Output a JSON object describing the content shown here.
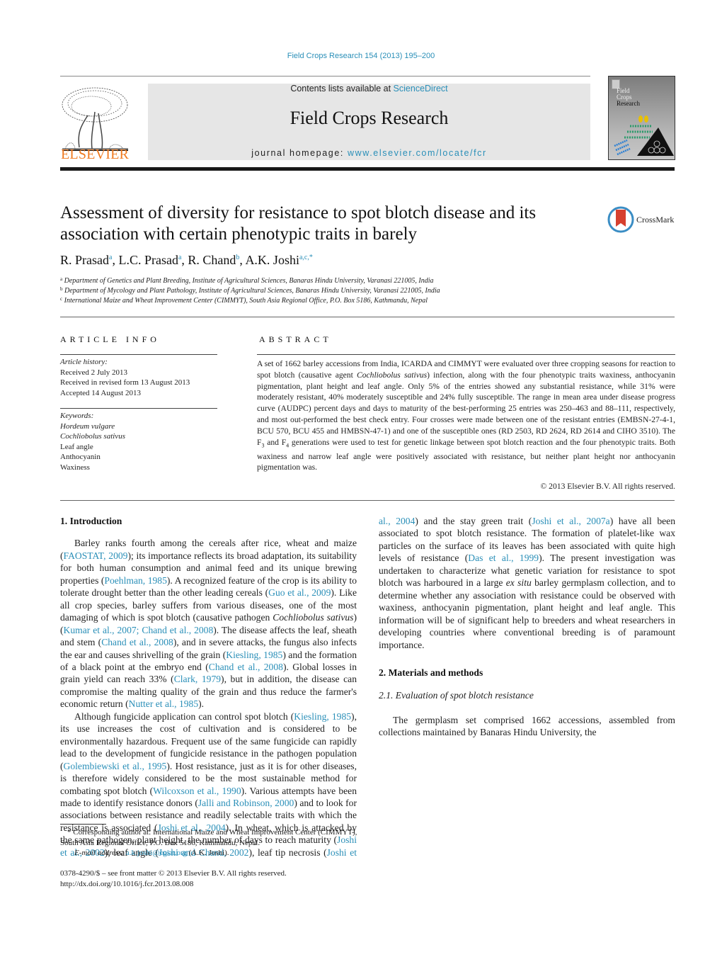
{
  "header": {
    "journal_reference": "Field Crops Research 154 (2013) 195–200",
    "publisher_logo_text": "ELSEVIER",
    "contents_prefix": "Contents lists available at ",
    "contents_link": "ScienceDirect",
    "journal_title": "Field Crops Research",
    "homepage_prefix": "journal homepage: ",
    "homepage_link": "www.elsevier.com/locate/fcr",
    "cover_title_lines": [
      "Field",
      "Crops",
      "Research"
    ]
  },
  "article": {
    "title": "Assessment of diversity for resistance to spot blotch disease and its association with certain phenotypic traits in barely",
    "crossmark_label": "CrossMark",
    "authors": [
      {
        "name": "R. Prasad",
        "sup": "a"
      },
      {
        "name": "L.C. Prasad",
        "sup": "a"
      },
      {
        "name": "R. Chand",
        "sup": "b"
      },
      {
        "name": "A.K. Joshi",
        "sup": "a,c,*"
      }
    ],
    "affiliations": [
      {
        "mark": "a",
        "text": "Department of Genetics and Plant Breeding, Institute of Agricultural Sciences, Banaras Hindu University, Varanasi 221005, India"
      },
      {
        "mark": "b",
        "text": "Department of Mycology and Plant Pathology, Institute of Agricultural Sciences, Banaras Hindu University, Varanasi 221005, India"
      },
      {
        "mark": "c",
        "text": "International Maize and Wheat Improvement Center (CIMMYT), South Asia Regional Office, P.O. Box 5186, Kathmandu, Nepal"
      }
    ]
  },
  "article_info": {
    "heading": "ARTICLE INFO",
    "history_label": "Article history:",
    "history": [
      "Received 2 July 2013",
      "Received in revised form 13 August 2013",
      "Accepted 14 August 2013"
    ],
    "keywords_label": "Keywords:",
    "keywords_italic": [
      "Hordeum vulgare",
      "Cochliobolus sativus"
    ],
    "keywords": [
      "Leaf angle",
      "Anthocyanin",
      "Waxiness"
    ]
  },
  "abstract": {
    "heading": "ABSTRACT",
    "part1": "A set of 1662 barley accessions from India, ICARDA and CIMMYT were evaluated over three cropping seasons for reaction to spot blotch (causative agent ",
    "species": "Cochliobolus sativus",
    "part2": ") infection, along with the four phenotypic traits waxiness, anthocyanin pigmentation, plant height and leaf angle. Only 5% of the entries showed any substantial resistance, while 31% were moderately resistant, 40% moderately susceptible and 24% fully susceptible. The range in mean area under disease progress curve (AUDPC) percent days and days to maturity of the best-performing 25 entries was 250–463 and 88–111, respectively, and most out-performed the best check entry. Four crosses were made between one of the resistant entries (EMBSN-27-4-1, BCU 570, BCU 455 and HMBSN-47-1) and one of the susceptible ones (RD 2503, RD 2624, RD 2614 and CIHO 3510). The F",
    "sub3": "3",
    "part3": " and F",
    "sub4": "4",
    "part4": " generations were used to test for genetic linkage between spot blotch reaction and the four phenotypic traits. Both waxiness and narrow leaf angle were positively associated with resistance, but neither plant height nor anthocyanin pigmentation was.",
    "copyright": "© 2013 Elsevier B.V. All rights reserved."
  },
  "intro": {
    "heading": "1.  Introduction",
    "p1": [
      {
        "t": "Barley ranks fourth among the cereals after rice, wheat and maize ("
      },
      {
        "l": "FAOSTAT, 2009"
      },
      {
        "t": "); its importance reflects its broad adaptation, its suitability for both human consumption and animal feed and its unique brewing properties ("
      },
      {
        "l": "Poehlman, 1985"
      },
      {
        "t": "). A recognized feature of the crop is its ability to tolerate drought better than the other leading cereals ("
      },
      {
        "l": "Guo et al., 2009"
      },
      {
        "t": "). Like all crop species, barley suffers from various diseases, one of the most damaging of which is spot blotch (causative pathogen "
      },
      {
        "i": "Cochliobolus sativus"
      },
      {
        "t": ") ("
      },
      {
        "l": "Kumar et al., 2007; Chand et al., 2008"
      },
      {
        "t": "). The disease affects the leaf, sheath and stem ("
      },
      {
        "l": "Chand et al., 2008"
      },
      {
        "t": "), and in severe attacks, the fungus also infects the ear and causes shrivelling of the grain ("
      },
      {
        "l": "Kiesling, 1985"
      },
      {
        "t": ") and the formation of a black point at the embryo end ("
      },
      {
        "l": "Chand et al., 2008"
      },
      {
        "t": "). Global losses in grain yield can reach 33% ("
      },
      {
        "l": "Clark, 1979"
      },
      {
        "t": "), but in addition, the disease can compromise the malting quality of the grain and thus reduce the farmer's economic return ("
      },
      {
        "l": "Nutter et al., 1985"
      },
      {
        "t": ")."
      }
    ],
    "p2": [
      {
        "t": "Although fungicide application can control spot blotch ("
      },
      {
        "l": "Kiesling, 1985"
      },
      {
        "t": "), its use increases the cost of cultivation and is considered to be environmentally hazardous. Frequent use of the same fungicide can rapidly lead to the development of fungicide resistance in the pathogen population ("
      },
      {
        "l": "Golembiewski et al., 1995"
      },
      {
        "t": "). Host resistance, just as it is for other diseases, is therefore widely considered to be the most sustainable method for combating spot blotch ("
      },
      {
        "l": "Wilcoxson et al., 1990"
      },
      {
        "t": "). Various attempts have been made to identify resistance donors ("
      },
      {
        "l": "Jalli and Robinson, 2000"
      },
      {
        "t": ") and to look for associations between resistance and readily selectable traits with which the resistance is associated ("
      },
      {
        "l": "Joshi et al., 2004"
      },
      {
        "t": "). In wheat, which is attacked by the same pathogen, plant height, the number of days to reach maturity ("
      },
      {
        "l": "Joshi et al., 2002"
      },
      {
        "t": "), leaf angle ("
      },
      {
        "l": "Joshi and Chand, 2002"
      },
      {
        "t": "), leaf tip necrosis ("
      },
      {
        "l": "Joshi et al., 2004"
      },
      {
        "t": ") and the stay green trait ("
      },
      {
        "l": "Joshi et al., 2007a"
      },
      {
        "t": ") have all been associated to spot blotch resistance. The formation of platelet-like wax particles on the surface of its leaves has been associated with quite high levels of resistance ("
      },
      {
        "l": "Das et al., 1999"
      },
      {
        "t": "). The present investigation was undertaken to characterize what genetic variation for resistance to spot blotch was harboured in a large "
      },
      {
        "i": "ex situ"
      },
      {
        "t": " barley germplasm collection, and to determine whether any association with resistance could be observed with waxiness, anthocyanin pigmentation, plant height and leaf angle. This information will be of significant help to breeders and wheat researchers in developing countries where conventional breeding is of paramount importance."
      }
    ]
  },
  "methods": {
    "heading": "2.  Materials and methods",
    "subheading": "2.1.  Evaluation of spot blotch resistance",
    "p1": "The germplasm set comprised 1662 accessions, assembled from collections maintained by Banaras Hindu University, the"
  },
  "footnotes": {
    "corresponding": "* Corresponding author at: International Maize and Wheat Improvement Center (CIMMYT), South Asia Regional Office, P.O. Box 5186, Kathmandu, Nepal.",
    "email_label": "E-mail address: ",
    "email": "a.k.joshi@cgiar.org",
    "email_suffix": " (A.K. Joshi).",
    "issn": "0378-4290/$ – see front matter © 2013 Elsevier B.V. All rights reserved.",
    "doi": "http://dx.doi.org/10.1016/j.fcr.2013.08.008"
  },
  "colors": {
    "link": "#2a8fb8",
    "elsevier_orange": "#f07a1f",
    "masthead_bg": "#e6e6e6"
  }
}
